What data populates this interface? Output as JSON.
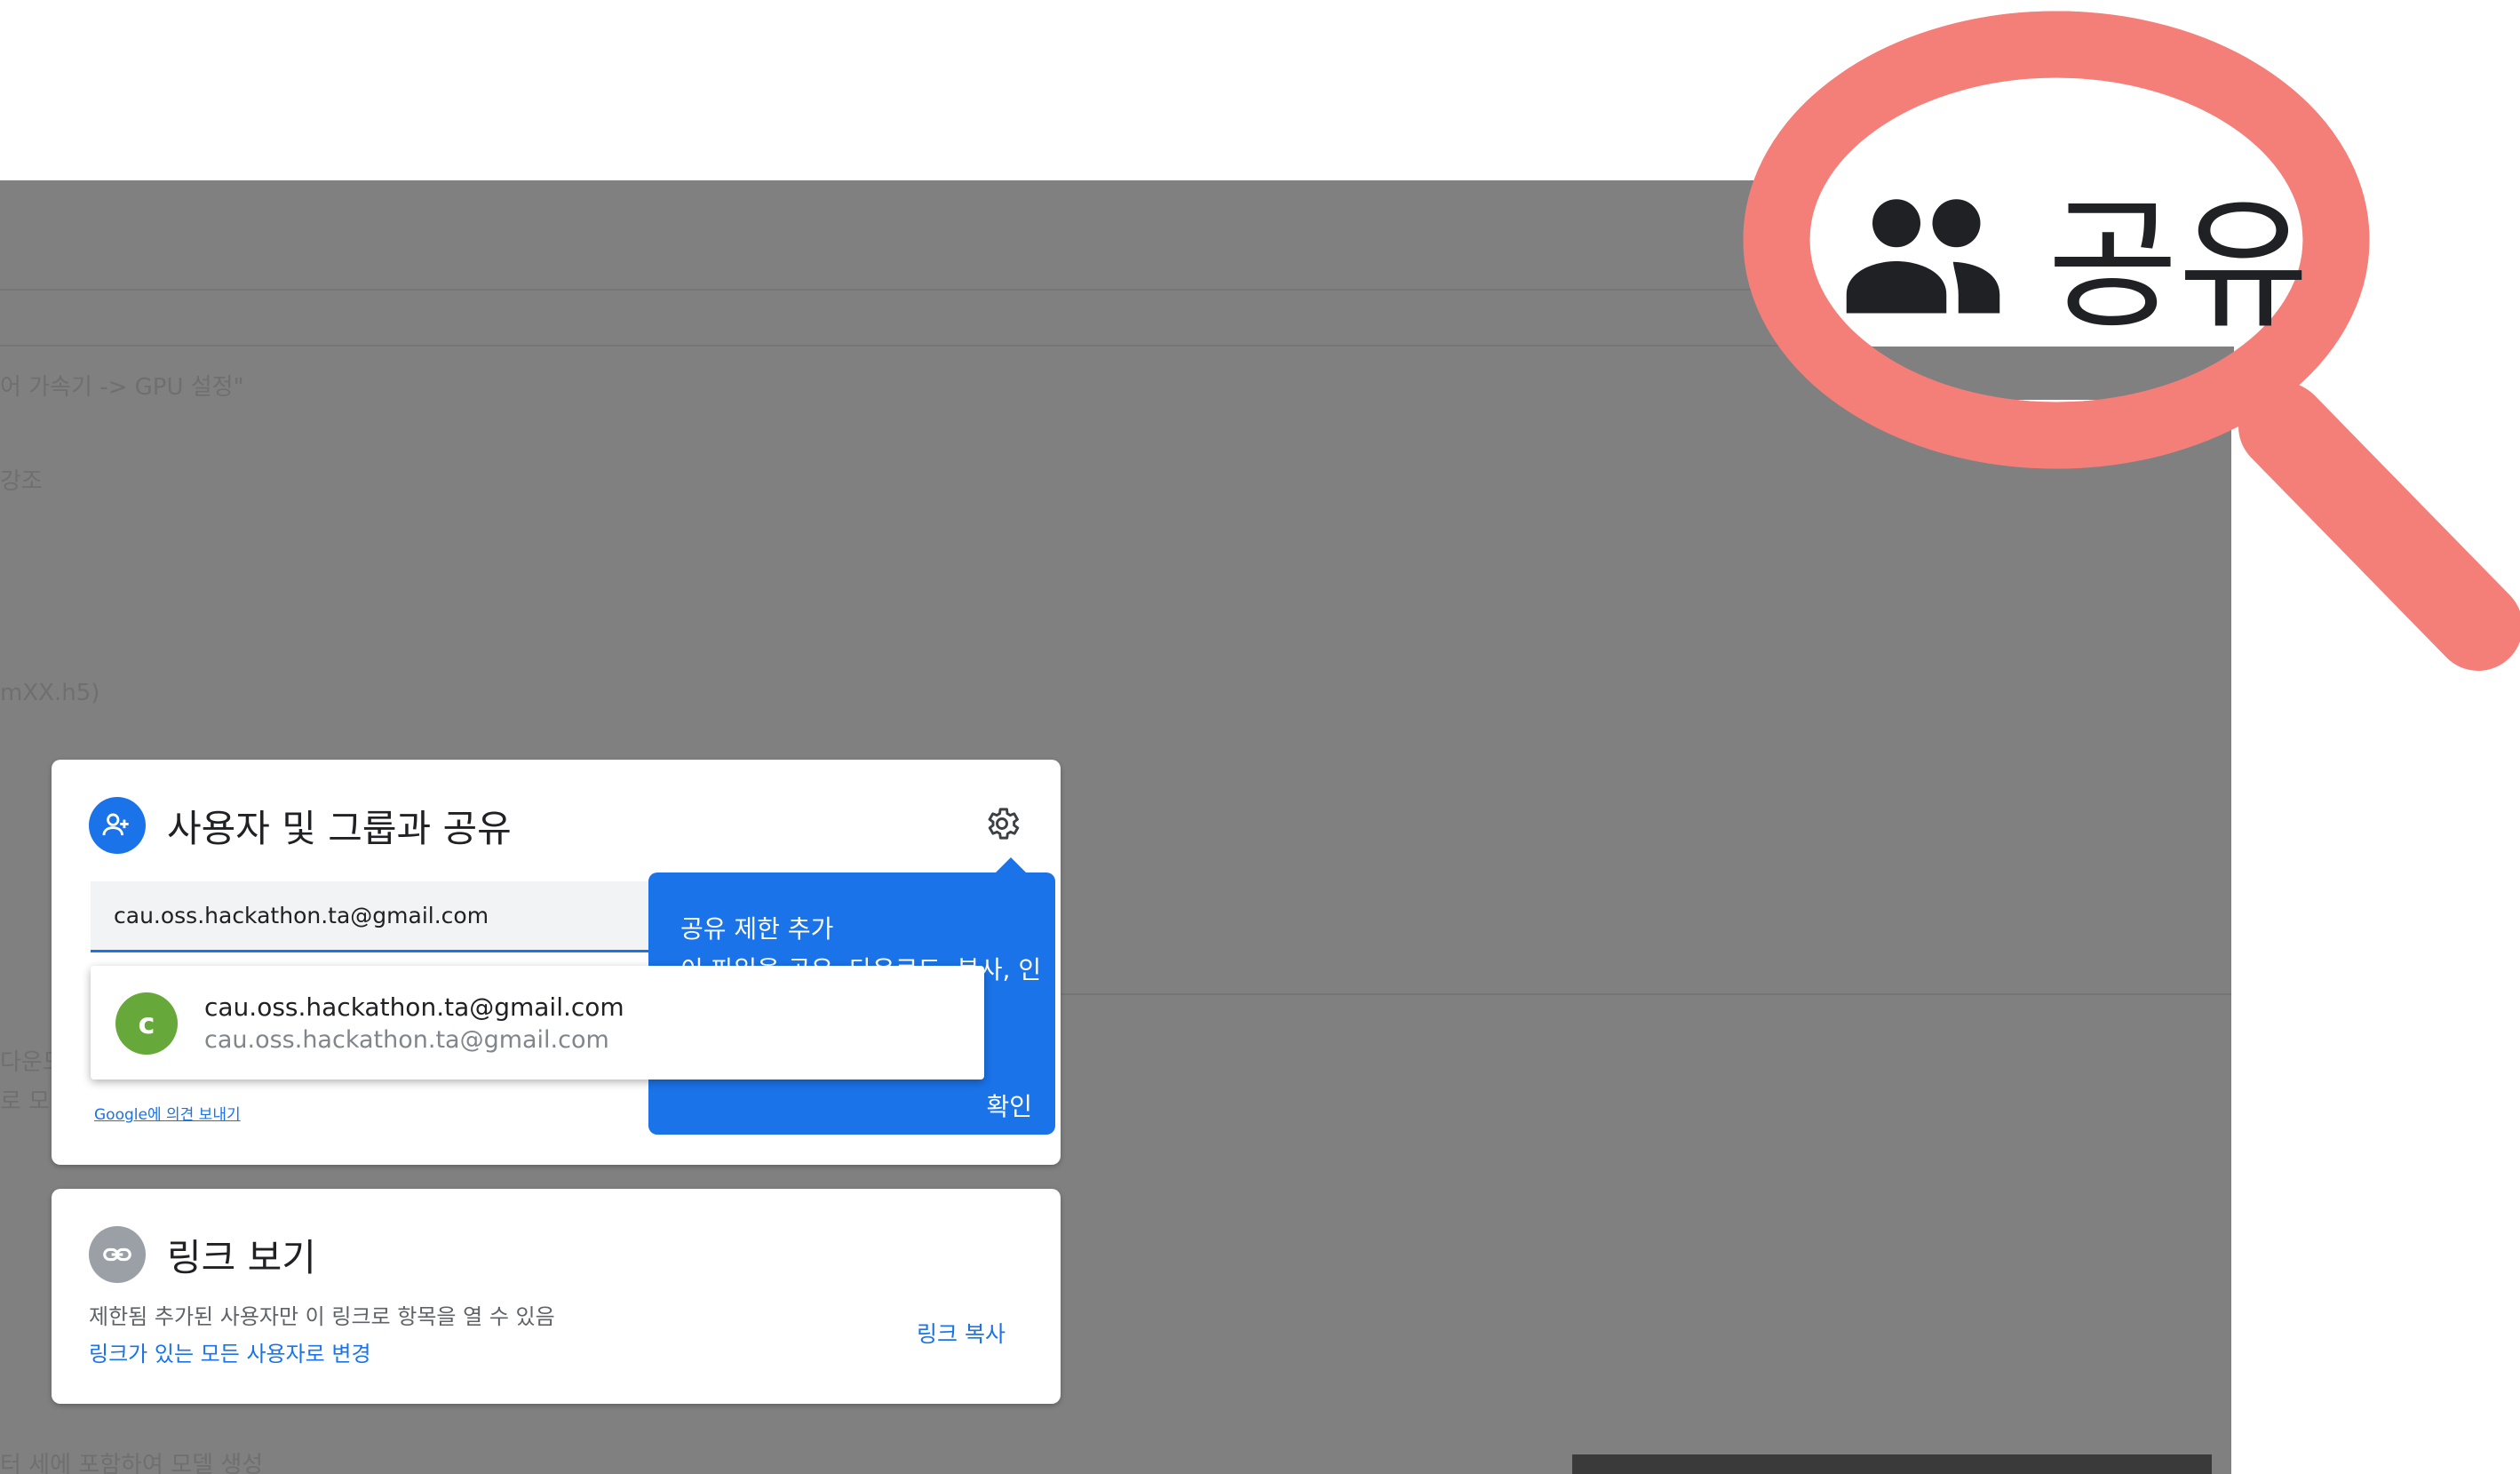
{
  "background_text": [
    "어 가속기 -> GPU 설정\"",
    "강조",
    "mXX.h5)",
    "다운도",
    "로 모",
    "터 세에 포함하여 모델 생성"
  ],
  "share_dialog": {
    "title": "사용자 및 그룹과 공유",
    "email_value": "cau.oss.hackathon.ta@gmail.com",
    "suggestion": {
      "avatar_letter": "c",
      "name": "cau.oss.hackathon.ta@gmail.com",
      "email": "cau.oss.hackathon.ta@gmail.com"
    },
    "feedback_link": "Google에 의견 보내기",
    "tooltip": {
      "title": "공유 제한 추가",
      "body": "이 파일을 공유, 다운로드, 복사, 인",
      "ok_label": "확인"
    },
    "icons": {
      "share": "person-add-icon",
      "settings": "gear-icon"
    }
  },
  "link_dialog": {
    "title": "링크 보기",
    "description": "제한됨 추가된 사용자만 이 링크로 항목을 열 수 있음",
    "change_link": "링크가 있는 모든 사용자로 변경",
    "copy_link": "링크 복사",
    "icons": {
      "link": "link-icon"
    }
  },
  "callout": {
    "label": "공유",
    "icons": {
      "people": "people-icon",
      "magnifier": "magnifier-icon"
    },
    "ring_color": "#f47f79"
  },
  "colors": {
    "overlay": "#808080",
    "primary_blue": "#1a73e8",
    "avatar_green": "#67a83b"
  }
}
